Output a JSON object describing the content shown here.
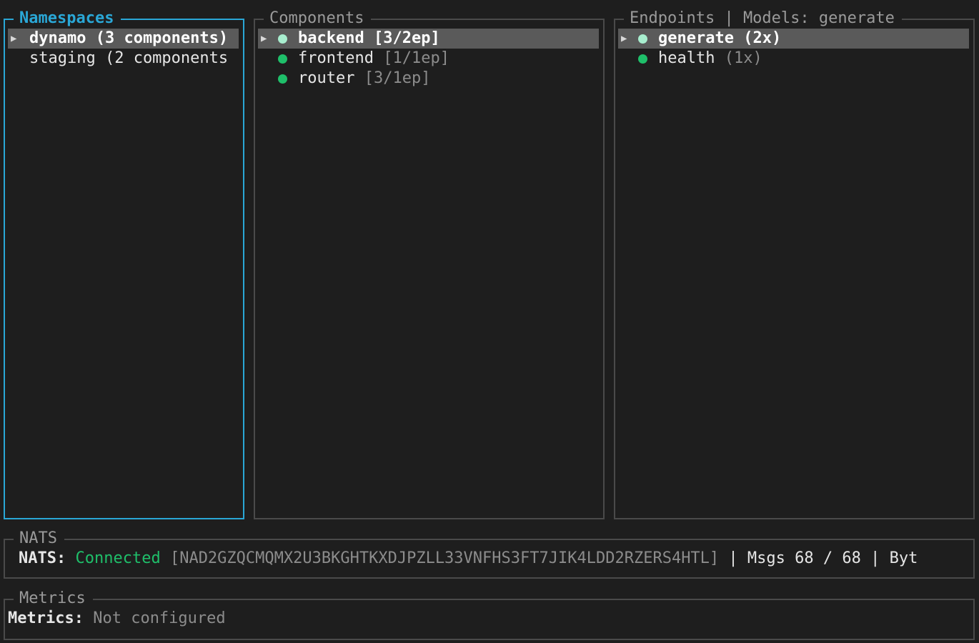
{
  "namespaces": {
    "title": "Namespaces",
    "items": [
      {
        "label": "dynamo (3 components)",
        "selected": true
      },
      {
        "label": "staging (2 components",
        "selected": false
      }
    ]
  },
  "components": {
    "title": "Components",
    "items": [
      {
        "name": "backend",
        "meta": "[3/2ep]",
        "selected": true
      },
      {
        "name": "frontend",
        "meta": "[1/1ep]",
        "selected": false
      },
      {
        "name": "router",
        "meta": "[3/1ep]",
        "selected": false
      }
    ]
  },
  "endpoints": {
    "title": "Endpoints | Models: generate",
    "items": [
      {
        "name": "generate",
        "meta": "(2x)",
        "selected": true
      },
      {
        "name": "health",
        "meta": "(1x)",
        "selected": false
      }
    ]
  },
  "nats": {
    "title": "NATS",
    "label": "NATS:",
    "status": "Connected",
    "server_id": "[NAD2GZQCMQMX2U3BKGHTKXDJPZLL33VNFHS3FT7JIK4LDD2RZERS4HTL]",
    "stats": " | Msgs 68 / 68 | Byt"
  },
  "metrics": {
    "title": "Metrics",
    "label": "Metrics:",
    "status": "Not configured"
  },
  "glyphs": {
    "caret": "▶"
  },
  "colors": {
    "focus_border": "#2aa7d6",
    "connected": "#1fbf6a",
    "selected_bg": "#5a5a5a"
  }
}
